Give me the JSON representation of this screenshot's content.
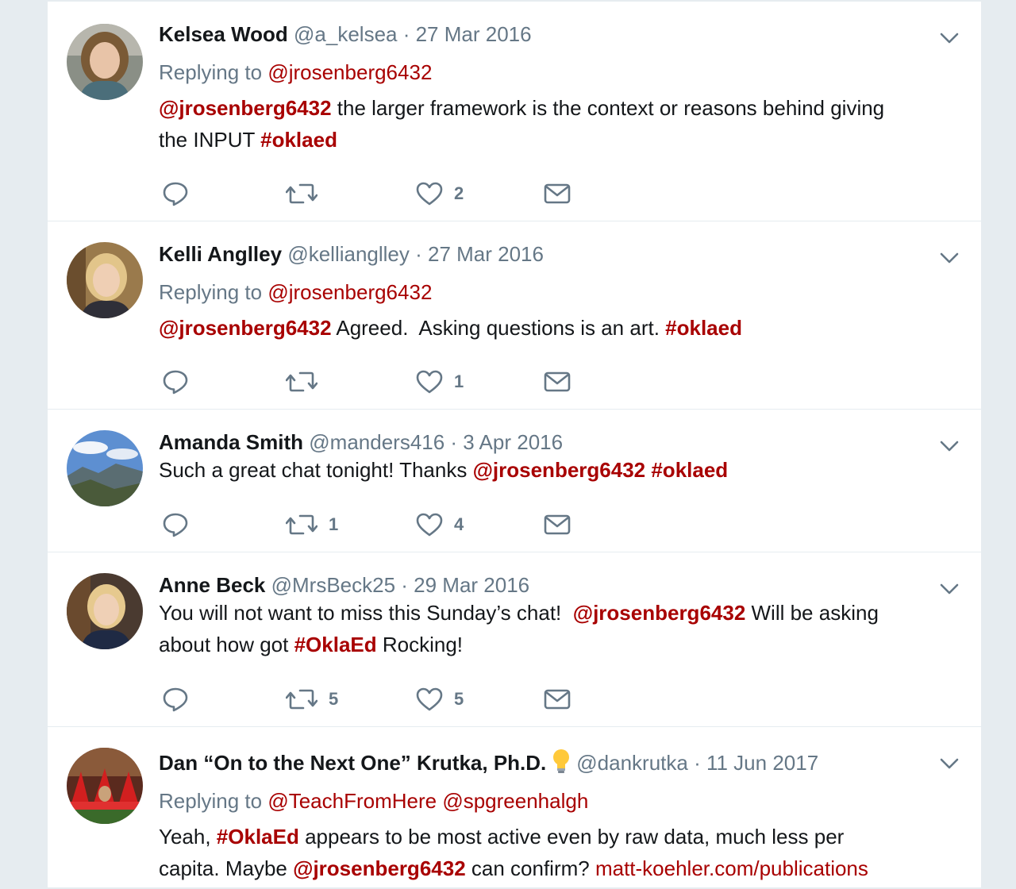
{
  "tweets": [
    {
      "name": "Kelsea Wood",
      "meta": "@a_kelsea · 27 Mar 2016",
      "reply_prefix": "Replying to",
      "reply_to": "@jrosenberg6432",
      "text_mention": "@jrosenberg6432",
      "text_body_1": " the larger framework is the context or reasons behind giving",
      "text_body_2": "the INPUT ",
      "text_tag": "#oklaed",
      "replies": "",
      "retweets": "",
      "likes": "2"
    },
    {
      "name": "Kelli Anglley",
      "meta": "@kellianglley · 27 Mar 2016",
      "reply_prefix": "Replying to",
      "reply_to": "@jrosenberg6432",
      "text_mention": "@jrosenberg6432",
      "text_body_1": " Agreed.  Asking questions is an art. ",
      "text_tag": "#oklaed",
      "replies": "",
      "retweets": "",
      "likes": "1"
    },
    {
      "name": "Amanda Smith",
      "meta": "@manders416 · 3 Apr 2016",
      "text_body_1": "Such a great chat tonight! Thanks ",
      "text_mention": "@jrosenberg6432",
      "text_tag": " #oklaed",
      "replies": "",
      "retweets": "1",
      "likes": "4"
    },
    {
      "name": "Anne Beck",
      "meta": "@MrsBeck25 · 29 Mar 2016",
      "text_body_1": "You will not want to miss this Sunday’s chat!  ",
      "text_mention": "@jrosenberg6432",
      "text_body_2": " Will be asking",
      "text_body_3": "about how got ",
      "text_tag": "#OklaEd",
      "text_body_4": " Rocking!",
      "replies": "",
      "retweets": "5",
      "likes": "5"
    },
    {
      "name": "Dan “On to the Next One” Krutka, Ph.D.",
      "meta": "@dankrutka · 11 Jun 2017",
      "badge_icon": "lightbulb-icon",
      "reply_prefix": "Replying to",
      "reply_to": "@TeachFromHere @spgreenhalgh",
      "text_body_1": "Yeah, ",
      "text_tag": "#OklaEd",
      "text_body_2": " appears to be most active even by raw data, much less per",
      "text_body_3": "capita. Maybe ",
      "text_mention": "@jrosenberg6432",
      "text_body_4": " can confirm? ",
      "text_link": "matt-koehler.com/publications"
    }
  ],
  "colors": {
    "accent": "#a80000",
    "muted": "#657786",
    "text": "#14171a",
    "background": "#e6ecf0"
  },
  "icons": [
    "reply-icon",
    "retweet-icon",
    "like-icon",
    "message-icon",
    "chevron-down-icon"
  ]
}
